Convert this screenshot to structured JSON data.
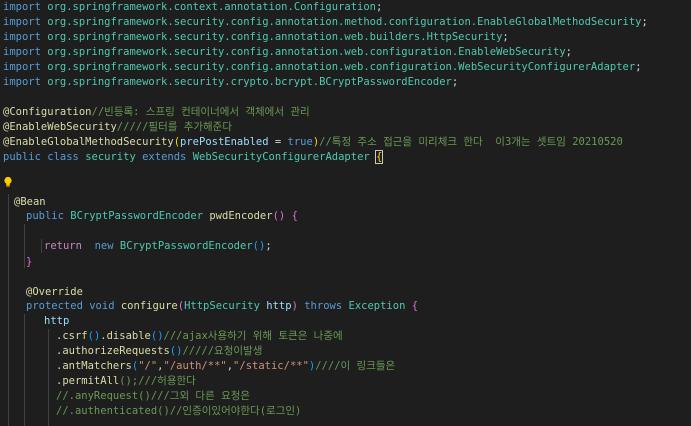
{
  "editor": {
    "imports": [
      {
        "kw": "import",
        "pkg": "org.springframework.context.annotation.",
        "cls": "Configuration"
      },
      {
        "kw": "import",
        "pkg": "org.springframework.security.config.annotation.method.configuration.",
        "cls": "EnableGlobalMethodSecurity"
      },
      {
        "kw": "import",
        "pkg": "org.springframework.security.config.annotation.web.builders.",
        "cls": "HttpSecurity"
      },
      {
        "kw": "import",
        "pkg": "org.springframework.security.config.annotation.web.configuration.",
        "cls": "EnableWebSecurity"
      },
      {
        "kw": "import",
        "pkg": "org.springframework.security.config.annotation.web.configuration.",
        "cls": "WebSecurityConfigurerAdapter"
      },
      {
        "kw": "import",
        "pkg": "org.springframework.security.crypto.bcrypt.",
        "cls": "BCryptPasswordEncoder"
      }
    ],
    "semi": ";",
    "at": "@",
    "ann_configuration": "Configuration",
    "cmt_configuration": "//빈등록: 스프링 컨테이너에서 객체에서 관리",
    "ann_enable_web": "EnableWebSecurity",
    "cmt_enable_web": "/////필터를 추가해준다",
    "ann_global": "EnableGlobalMethodSecurity",
    "paren_open": "(",
    "paren_close": ")",
    "param_prepost": "prePostEnabled",
    "eq": " = ",
    "val_true": "true",
    "cmt_global": "//특정 주소 접근을 미리체크 한다  이3개는 셋트임 20210520",
    "kw_public": "public",
    "kw_class": "class",
    "class_name": "security",
    "kw_extends": "extends",
    "class_parent": "WebSecurityConfigurerAdapter",
    "brace_open": "{",
    "brace_close": "}",
    "ann_bean": "Bean",
    "type_encoder": "BCryptPasswordEncoder",
    "method_pwd": "pwdEncoder",
    "empty_parens": "()",
    "kw_return": "return",
    "kw_new": "new",
    "ann_override": "Override",
    "kw_protected": "protected",
    "kw_void": "void",
    "method_configure": "configure",
    "type_http": "HttpSecurity",
    "param_http": "http",
    "kw_throws": "throws",
    "type_exception": "Exception",
    "dot": ".",
    "m_csrf": "csrf",
    "m_disable": "disable",
    "cmt_csrf": "///ajax사용하기 위해 토큰은 나중에",
    "m_authorize": "authorizeRequests",
    "cmt_authorize": "/////요청이발생",
    "m_ant": "antMatchers",
    "str_root": "\"/\"",
    "comma": ",",
    "str_auth": "\"/auth/**\"",
    "str_static": "\"/static/**\"",
    "cmt_ant": "////이 링크들은",
    "m_permit": "permitAll",
    "cmt_permit": "();///허용한다",
    "cmt_any": "//.anyRequest()///그외 다른 요청은",
    "cmt_auth": "//.authenticated()//인증이있어야한다(로그인)"
  }
}
